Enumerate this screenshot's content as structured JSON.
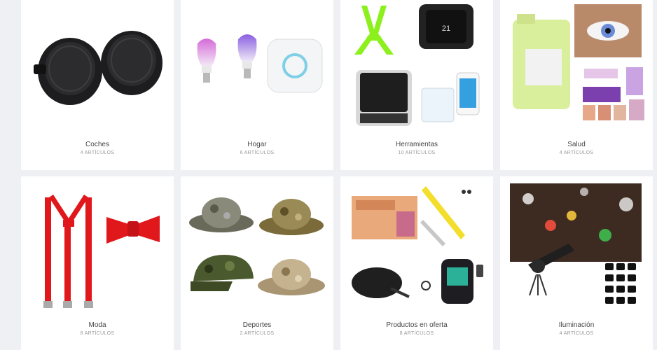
{
  "categories": [
    {
      "title": "Coches",
      "subtitle": "4 ARTÍCULOS",
      "icon": "magnetic-car-mount-icon"
    },
    {
      "title": "Hogar",
      "subtitle": "6 ARTÍCULOS",
      "icon": "smart-bulbs-icon"
    },
    {
      "title": "Herramientas",
      "subtitle": "10 ARTÍCULOS",
      "icon": "thermostat-icon"
    },
    {
      "title": "Salud",
      "subtitle": "4 ARTÍCULOS",
      "icon": "health-products-icon"
    },
    {
      "title": "Moda",
      "subtitle": "8 ARTÍCULOS",
      "icon": "suspenders-bowtie-icon"
    },
    {
      "title": "Deportes",
      "subtitle": "2 ARTÍCULOS",
      "icon": "camo-hats-icon"
    },
    {
      "title": "Productos en oferta",
      "subtitle": "8 ARTÍCULOS",
      "icon": "offer-products-icon"
    },
    {
      "title": "Iluminación",
      "subtitle": "4 ARTÍCULOS",
      "icon": "christmas-projector-icon"
    }
  ],
  "colors": {
    "page_background": "#eef0f3",
    "card_background": "#ffffff",
    "title_text": "#444444",
    "subtitle_text": "#9a9a9a"
  }
}
